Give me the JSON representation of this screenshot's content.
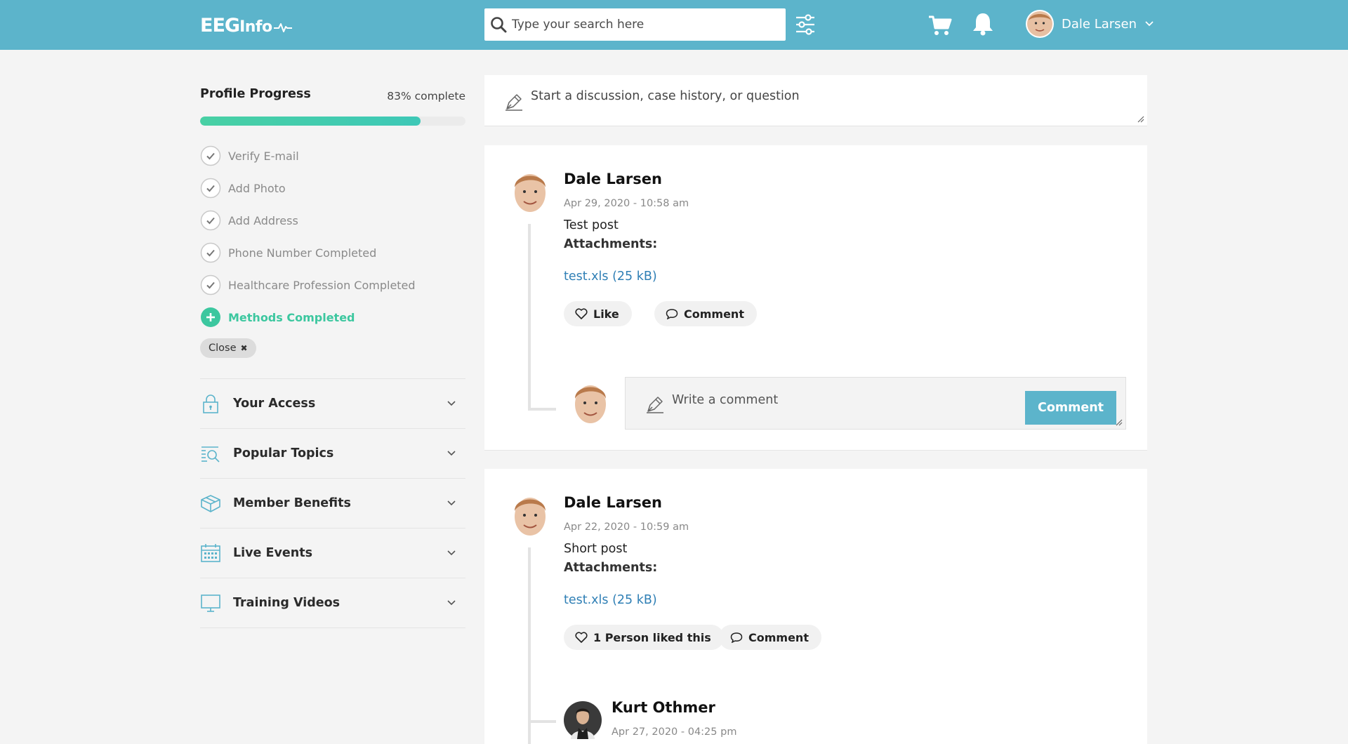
{
  "brand": {
    "logo_main": "EEG",
    "logo_sub": "Info"
  },
  "header": {
    "search_placeholder": "Type your search here",
    "user_name": "Dale Larsen",
    "icons": [
      "search-icon",
      "filter-sliders-icon",
      "cart-icon",
      "bell-icon",
      "chevron-down-icon"
    ]
  },
  "sidebar": {
    "progress": {
      "title": "Profile Progress",
      "percent_label": "83% complete",
      "percent": 83
    },
    "steps": [
      {
        "label": "Verify E-mail",
        "state": "done"
      },
      {
        "label": "Add Photo",
        "state": "done"
      },
      {
        "label": "Add Address",
        "state": "done"
      },
      {
        "label": "Phone Number Completed",
        "state": "done"
      },
      {
        "label": "Healthcare Profession Completed",
        "state": "done"
      },
      {
        "label": "Methods Completed",
        "state": "active"
      }
    ],
    "close_label": "Close",
    "sections": [
      {
        "label": "Your Access",
        "icon": "lock-icon"
      },
      {
        "label": "Popular Topics",
        "icon": "topics-search-icon"
      },
      {
        "label": "Member Benefits",
        "icon": "gift-box-icon"
      },
      {
        "label": "Live Events",
        "icon": "calendar-icon"
      },
      {
        "label": "Training Videos",
        "icon": "monitor-icon"
      }
    ]
  },
  "composer": {
    "placeholder": "Start a discussion, case history, or question"
  },
  "posts": [
    {
      "author": "Dale Larsen",
      "date": "Apr 29, 2020 - 10:58 am",
      "body": "Test post",
      "attachments_label": "Attachments:",
      "file": "test.xls (25 kB)",
      "like_label": "Like",
      "comment_label": "Comment",
      "comment_placeholder": "Write a comment",
      "comment_submit": "Comment"
    },
    {
      "author": "Dale Larsen",
      "date": "Apr 22, 2020 - 10:59 am",
      "body": "Short post",
      "attachments_label": "Attachments:",
      "file": "test.xls (25 kB)",
      "like_label": "1 Person liked this",
      "comment_label": "Comment",
      "reply": {
        "author": "Kurt Othmer",
        "date": "Apr 27, 2020 - 04:25 pm"
      }
    }
  ],
  "colors": {
    "brand": "#5cb4cb",
    "accent_green": "#3cc79f",
    "link": "#2f7fb5"
  }
}
